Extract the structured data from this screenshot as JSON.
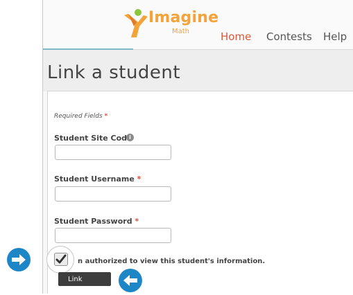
{
  "header": {
    "logo_word": "Imagine",
    "logo_sub": "Math",
    "nav": [
      {
        "label": "Home"
      },
      {
        "label": "Contests"
      },
      {
        "label": "Help"
      }
    ]
  },
  "page": {
    "title": "Link a student"
  },
  "form": {
    "required_note": "Required Fields",
    "required_star": "*",
    "site_code": {
      "label": "Student Site Code",
      "value": "",
      "placeholder": ""
    },
    "username": {
      "label": "Student Username",
      "value": "",
      "placeholder": ""
    },
    "password": {
      "label": "Student Password",
      "value": "",
      "placeholder": ""
    },
    "authorization_text": "n authorized to view this student's information.",
    "authorization_checked": true,
    "submit_label": "Link"
  },
  "colors": {
    "accent": "#d9583b",
    "logo": "#f2a33a",
    "required": "#e0523a",
    "pointer_arrow": "#1d86c7",
    "button": "#3d3d3d"
  },
  "icons": {
    "info": "info-icon",
    "check": "checkmark-icon",
    "pointer_right": "arrow-right-icon",
    "pointer_left": "arrow-left-icon"
  }
}
